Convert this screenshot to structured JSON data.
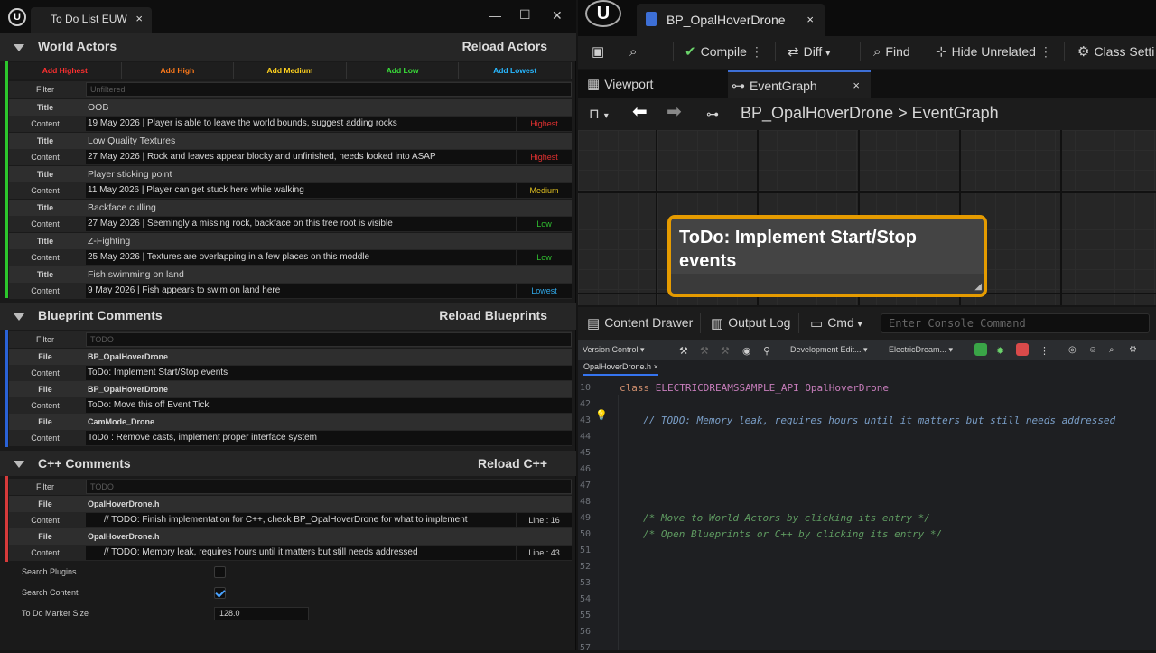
{
  "left_window": {
    "tab_title": "To Do List EUW",
    "close": "×",
    "controls": {
      "minimize": "—",
      "maximize": "☐",
      "close": "✕"
    }
  },
  "world_actors": {
    "title": "World Actors",
    "reload": "Reload Actors",
    "add_buttons": [
      {
        "label": "Add Highest",
        "color": "#ff3030"
      },
      {
        "label": "Add High",
        "color": "#ff7a1a"
      },
      {
        "label": "Add Medium",
        "color": "#ffd21e"
      },
      {
        "label": "Add Low",
        "color": "#3adf3a"
      },
      {
        "label": "Add Lowest",
        "color": "#28b8ff"
      }
    ],
    "filter_label": "Filter",
    "filter_placeholder": "Unfiltered",
    "title_label": "Title",
    "content_label": "Content",
    "items": [
      {
        "title": "OOB",
        "content": "19 May 2026 | Player is able to leave the world bounds, suggest adding rocks",
        "priority": "Highest",
        "color": "#e03030"
      },
      {
        "title": "Low Quality Textures",
        "content": "27 May 2026 | Rock and leaves appear blocky and unfinished, needs looked into ASAP",
        "priority": "Highest",
        "color": "#e03030"
      },
      {
        "title": "Player sticking point",
        "content": "11 May 2026 | Player can get stuck here while walking",
        "priority": "Medium",
        "color": "#e0c020"
      },
      {
        "title": "Backface culling",
        "content": "27 May 2026 | Seemingly a missing rock, backface on this tree root is visible",
        "priority": "Low",
        "color": "#30c030"
      },
      {
        "title": "Z-Fighting",
        "content": "25 May 2026 | Textures are overlapping in a few places on this moddle",
        "priority": "Low",
        "color": "#30c030"
      },
      {
        "title": "Fish swimming on land",
        "content": "9 May 2026 | Fish appears to swim on land here",
        "priority": "Lowest",
        "color": "#30a8e8"
      }
    ]
  },
  "blueprint_comments": {
    "title": "Blueprint Comments",
    "reload": "Reload Blueprints",
    "filter_label": "Filter",
    "filter_placeholder": "TODO",
    "file_label": "File",
    "content_label": "Content",
    "items": [
      {
        "file": "BP_OpalHoverDrone",
        "content": "ToDo: Implement Start/Stop events"
      },
      {
        "file": "BP_OpalHoverDrone",
        "content": "ToDo: Move this off Event Tick"
      },
      {
        "file": "CamMode_Drone",
        "content": "ToDo : Remove casts, implement proper interface system"
      }
    ]
  },
  "cpp_comments": {
    "title": "C++ Comments",
    "reload": "Reload C++",
    "filter_label": "Filter",
    "filter_placeholder": "TODO",
    "file_label": "File",
    "content_label": "Content",
    "items": [
      {
        "file": "OpalHoverDrone.h",
        "content": "// TODO: Finish implementation for C++, check BP_OpalHoverDrone for what to implement",
        "line": "Line : 16"
      },
      {
        "file": "OpalHoverDrone.h",
        "content": "// TODO: Memory leak, requires hours until it matters but still needs addressed",
        "line": "Line : 43"
      }
    ]
  },
  "options": {
    "search_plugins": {
      "label": "Search Plugins",
      "checked": false
    },
    "search_content": {
      "label": "Search Content",
      "checked": true
    },
    "marker_size": {
      "label": "To Do Marker Size",
      "value": "128.0"
    }
  },
  "editor": {
    "asset_tab": "BP_OpalHoverDrone",
    "close": "×",
    "toolbar": {
      "compile": "Compile",
      "diff": "Diff",
      "find": "Find",
      "hide_unrelated": "Hide Unrelated",
      "class_settings": "Class Setti"
    },
    "tabs": {
      "viewport": "Viewport",
      "event_graph": "EventGraph"
    },
    "breadcrumb": {
      "asset": "BP_OpalHoverDrone",
      "sep": ">",
      "graph": "EventGraph"
    },
    "comment_node": "ToDo: Implement Start/Stop events",
    "bottom_bar": {
      "content_drawer": "Content Drawer",
      "output_log": "Output Log",
      "cmd": "Cmd",
      "console_placeholder": "Enter Console Command"
    }
  },
  "ide": {
    "version_control": "Version Control",
    "config": "Development Edit...",
    "project": "ElectricDream...",
    "file_tab": "OpalHoverDrone.h",
    "lines": [
      {
        "no": "10",
        "text": "class ELECTRICDREAMSSAMPLE_API OpalHoverDrone"
      },
      {
        "no": "42",
        "text": ""
      },
      {
        "no": "43",
        "text": "// TODO: Memory leak, requires hours until it matters but still needs addressed"
      },
      {
        "no": "44",
        "text": ""
      },
      {
        "no": "45",
        "text": ""
      },
      {
        "no": "46",
        "text": ""
      },
      {
        "no": "47",
        "text": ""
      },
      {
        "no": "48",
        "text": ""
      },
      {
        "no": "49",
        "text": "/* Move to World Actors by clicking its entry */"
      },
      {
        "no": "50",
        "text": "/* Open Blueprints or C++ by clicking its entry */"
      },
      {
        "no": "51",
        "text": ""
      },
      {
        "no": "52",
        "text": ""
      },
      {
        "no": "53",
        "text": ""
      },
      {
        "no": "54",
        "text": ""
      },
      {
        "no": "55",
        "text": ""
      },
      {
        "no": "56",
        "text": ""
      },
      {
        "no": "57",
        "text": ""
      }
    ]
  }
}
